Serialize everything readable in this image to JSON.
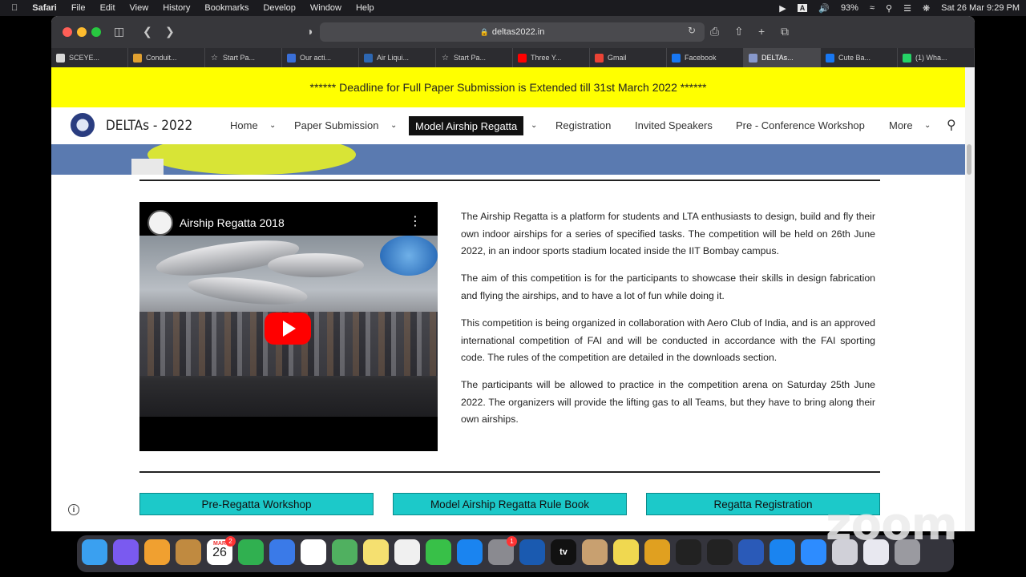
{
  "menubar": {
    "app": "Safari",
    "items": [
      "File",
      "Edit",
      "View",
      "History",
      "Bookmarks",
      "Develop",
      "Window",
      "Help"
    ],
    "battery": "93%",
    "datetime": "Sat 26 Mar  9:29 PM"
  },
  "browser": {
    "url": "deltas2022.in",
    "tabs": [
      {
        "label": "SCEYE...",
        "icon": "doc-icon",
        "color": "#d8d8d8"
      },
      {
        "label": "Conduit...",
        "icon": "doc-icon",
        "color": "#e0a030"
      },
      {
        "label": "Start Pa...",
        "icon": "star-icon",
        "color": "#2c2c30"
      },
      {
        "label": "Our acti...",
        "icon": "doc-icon",
        "color": "#3a6fd8"
      },
      {
        "label": "Air Liqui...",
        "icon": "linkedin-icon",
        "color": "#2d67b2"
      },
      {
        "label": "Start Pa...",
        "icon": "star-icon",
        "color": "#2c2c30"
      },
      {
        "label": "Three Y...",
        "icon": "youtube-icon",
        "color": "#ff0000"
      },
      {
        "label": "Gmail",
        "icon": "gmail-icon",
        "color": "#ea4335"
      },
      {
        "label": "Facebook",
        "icon": "facebook-icon",
        "color": "#1877f2"
      },
      {
        "label": "DELTAs...",
        "icon": "deltas-icon",
        "color": "#8899cc"
      },
      {
        "label": "Cute Ba...",
        "icon": "facebook-icon",
        "color": "#1877f2"
      },
      {
        "label": "(1) Wha...",
        "icon": "whatsapp-icon",
        "color": "#25d366"
      }
    ],
    "active_tab": 9
  },
  "site": {
    "banner": "****** Deadline for Full Paper Submission is Extended till 31st March 2022 ******",
    "name": "DELTAs - 2022",
    "nav": {
      "home": "Home",
      "paper_submission": "Paper Submission",
      "model_airship": "Model Airship Regatta",
      "registration": "Registration",
      "invited_speakers": "Invited Speakers",
      "pre_conference": "Pre - Conference Workshop",
      "more": "More"
    }
  },
  "video": {
    "title": "Airship Regatta 2018"
  },
  "article": {
    "p1": "The Airship Regatta is a platform for students and LTA enthusiasts to design, build and fly their own indoor airships for a series of specified tasks. The competition will be held on 26th June 2022, in an indoor sports stadium located inside the IIT Bombay campus.",
    "p2": "The aim of this competition is for the participants to showcase their skills in design fabrication and flying the airships, and to have a lot of fun while doing it.",
    "p3": "This competition is being organized in collaboration with Aero Club of India, and is an approved international competition of FAI and will be conducted in accordance with the FAI sporting code. The rules of the competition are detailed in the downloads section.",
    "p4": "The participants will be allowed to practice in the competition arena on Saturday 25th June 2022. The organizers will provide the lifting gas to all Teams, but they have to bring along their own airships."
  },
  "buttons": {
    "workshop": "Pre-Regatta Workshop",
    "rulebook": "Model Airship Regatta Rule Book",
    "registration": "Regatta Registration"
  },
  "dock": {
    "calendar_month": "MAR",
    "calendar_day": "26",
    "calendar_badge": "2",
    "settings_badge": "1",
    "appletv_label": "tv",
    "apps": [
      "finder-icon",
      "siri-icon",
      "launchpad-icon",
      "notes-app-icon",
      "calendar-icon",
      "numbers-icon",
      "mail-icon",
      "reminders-icon",
      "maps-icon",
      "notes-icon",
      "photos-icon",
      "messages-icon",
      "appstore-icon",
      "settings-icon",
      "quicktime-icon",
      "appletv-icon",
      "preview-icon",
      "stickies-icon",
      "gamecenter-icon",
      "terminal-icon",
      "activity-monitor-icon",
      "word-icon",
      "safari-icon",
      "zoom-icon",
      "screenshot-icon",
      "bluetooth-icon",
      "trash-icon"
    ]
  },
  "watermark": "zoom"
}
